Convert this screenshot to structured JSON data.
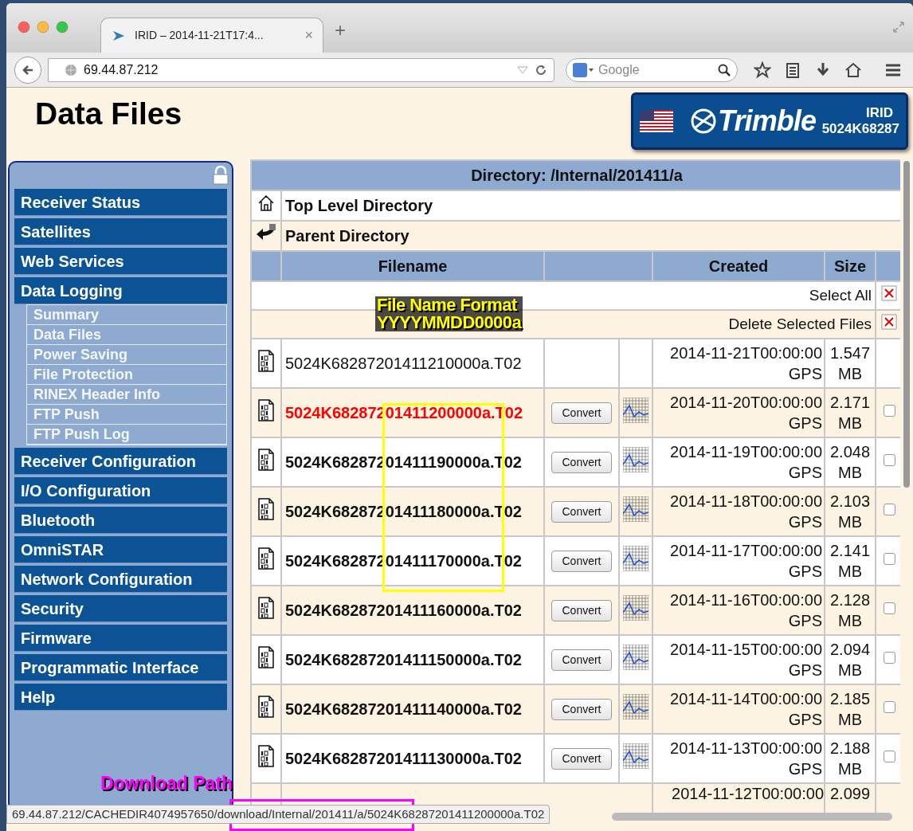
{
  "browser": {
    "tab_title": "IRID – 2014-11-21T17:4...",
    "tab_close": "×",
    "new_tab": "+",
    "address": "69.44.87.212",
    "search_placeholder": "Google"
  },
  "page": {
    "title": "Data Files",
    "logo": {
      "brand": "Trimble",
      "model": "IRID",
      "serial": "5024K68287"
    }
  },
  "sidebar": {
    "items": [
      {
        "label": "Receiver Status"
      },
      {
        "label": "Satellites"
      },
      {
        "label": "Web Services"
      },
      {
        "label": "Data Logging",
        "expanded": true,
        "children": [
          {
            "label": "Summary"
          },
          {
            "label": "Data Files"
          },
          {
            "label": "Power Saving"
          },
          {
            "label": "File Protection"
          },
          {
            "label": "RINEX Header Info"
          },
          {
            "label": "FTP Push"
          },
          {
            "label": "FTP Push Log"
          }
        ]
      },
      {
        "label": "Receiver Configuration"
      },
      {
        "label": "I/O Configuration"
      },
      {
        "label": "Bluetooth"
      },
      {
        "label": "OmniSTAR"
      },
      {
        "label": "Network Configuration"
      },
      {
        "label": "Security"
      },
      {
        "label": "Firmware"
      },
      {
        "label": "Programmatic Interface"
      },
      {
        "label": "Help"
      }
    ]
  },
  "table": {
    "directory": "Directory: /Internal/201411/a",
    "nav_rows": [
      {
        "kind": "home",
        "label": "Top Level Directory"
      },
      {
        "kind": "parent",
        "label": "Parent Directory"
      }
    ],
    "columns": [
      "Filename",
      "Created",
      "Size"
    ],
    "select_all": "Select All",
    "delete_selected": "Delete Selected Files",
    "files": [
      {
        "kind": "file",
        "name": "5024K68287201411210000a.T02",
        "complete": false,
        "highlighted": false,
        "created": "2014-11-21T00:00:00 GPS",
        "size": "1.547 MB"
      },
      {
        "kind": "file",
        "name": "5024K68287201411200000a.T02",
        "complete": true,
        "highlighted": true,
        "convert": "Convert",
        "created": "2014-11-20T00:00:00 GPS",
        "size": "2.171 MB",
        "checked": false
      },
      {
        "kind": "file",
        "name": "5024K68287201411190000a.T02",
        "complete": true,
        "highlighted": false,
        "convert": "Convert",
        "created": "2014-11-19T00:00:00 GPS",
        "size": "2.048 MB",
        "checked": false
      },
      {
        "kind": "file",
        "name": "5024K68287201411180000a.T02",
        "complete": true,
        "highlighted": false,
        "convert": "Convert",
        "created": "2014-11-18T00:00:00 GPS",
        "size": "2.103 MB",
        "checked": false
      },
      {
        "kind": "file",
        "name": "5024K68287201411170000a.T02",
        "complete": true,
        "highlighted": false,
        "convert": "Convert",
        "created": "2014-11-17T00:00:00 GPS",
        "size": "2.141 MB",
        "checked": false
      },
      {
        "kind": "file",
        "name": "5024K68287201411160000a.T02",
        "complete": true,
        "highlighted": false,
        "convert": "Convert",
        "created": "2014-11-16T00:00:00 GPS",
        "size": "2.128 MB",
        "checked": false
      },
      {
        "kind": "file",
        "name": "5024K68287201411150000a.T02",
        "complete": true,
        "highlighted": false,
        "convert": "Convert",
        "created": "2014-11-15T00:00:00 GPS",
        "size": "2.094 MB",
        "checked": false
      },
      {
        "kind": "file",
        "name": "5024K68287201411140000a.T02",
        "complete": true,
        "highlighted": false,
        "convert": "Convert",
        "created": "2014-11-14T00:00:00 GPS",
        "size": "2.185 MB",
        "checked": false
      },
      {
        "kind": "file",
        "name": "5024K68287201411130000a.T02",
        "complete": true,
        "highlighted": false,
        "convert": "Convert",
        "created": "2014-11-13T00:00:00 GPS",
        "size": "2.188 MB",
        "checked": false
      },
      {
        "kind": "partial",
        "created": "2014-11-12T00:00:00",
        "size": "2.099"
      }
    ]
  },
  "annotations": [
    {
      "kind": "format_note",
      "lines": [
        "File Name Format",
        "YYYYMMDD0000a"
      ]
    },
    {
      "kind": "path_note",
      "text": "Download Path"
    }
  ],
  "status_bar": "69.44.87.212/CACHEDIR4074957650/download/Internal/201411/a/5024K68287201411200000a.T02"
}
